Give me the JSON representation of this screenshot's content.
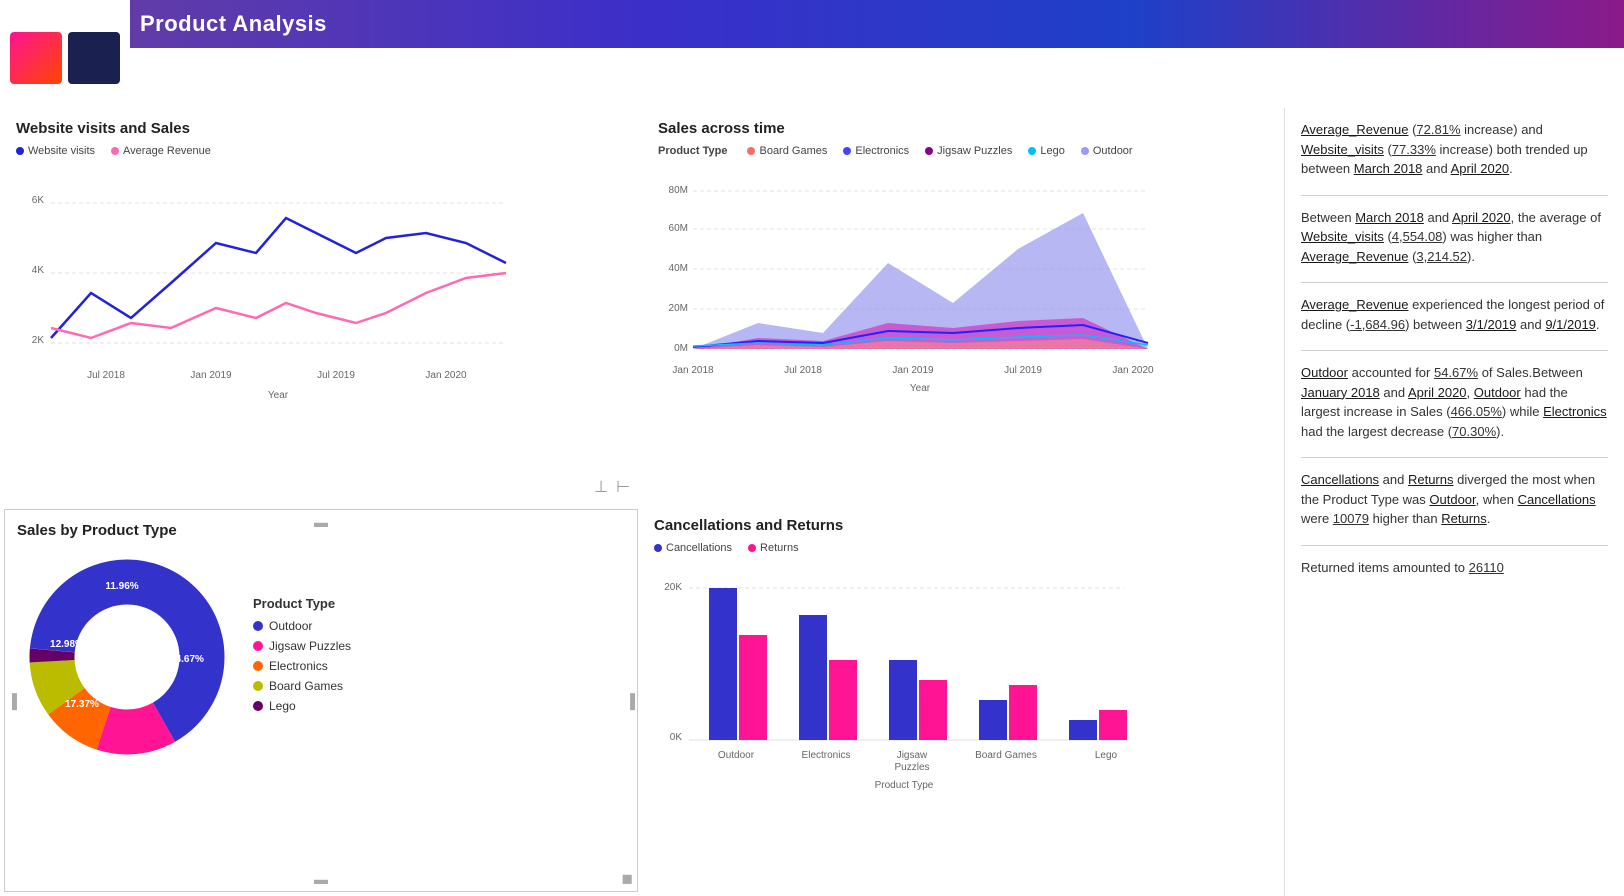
{
  "header": {
    "title": "Product Analysis"
  },
  "websiteChart": {
    "title": "Website visits and Sales",
    "legend": [
      {
        "label": "Website visits",
        "color": "#2222DD"
      },
      {
        "label": "Average Revenue",
        "color": "#FF69B4"
      }
    ],
    "xLabels": [
      "Jul 2018",
      "Jan 2019",
      "Jul 2019",
      "Jan 2020"
    ],
    "yLabels": [
      "6K",
      "4K",
      "2K"
    ],
    "xAxisLabel": "Year"
  },
  "salesTimeChart": {
    "title": "Sales across time",
    "legendLabel": "Product Type",
    "legend": [
      {
        "label": "Board Games",
        "color": "#FF6B6B"
      },
      {
        "label": "Electronics",
        "color": "#4444FF"
      },
      {
        "label": "Jigsaw Puzzles",
        "color": "#880088"
      },
      {
        "label": "Lego",
        "color": "#00BFFF"
      },
      {
        "label": "Outdoor",
        "color": "#9999FF"
      }
    ],
    "yLabels": [
      "80M",
      "60M",
      "40M",
      "20M",
      "0M"
    ],
    "xLabels": [
      "Jan 2018",
      "Jul 2018",
      "Jan 2019",
      "Jul 2019",
      "Jan 2020"
    ],
    "xAxisLabel": "Year"
  },
  "salesByProduct": {
    "title": "Sales by Product Type",
    "segments": [
      {
        "label": "Outdoor",
        "color": "#3333CC",
        "percent": "54.67%",
        "value": 54.67
      },
      {
        "label": "Jigsaw Puzzles",
        "color": "#FF1493",
        "percent": "17.37%",
        "value": 17.37
      },
      {
        "label": "Electronics",
        "color": "#FF6600",
        "percent": "12.98%",
        "value": 12.98
      },
      {
        "label": "Board Games",
        "color": "#CCCC00",
        "percent": "11.96%",
        "value": 11.96
      },
      {
        "label": "Lego",
        "color": "#660066",
        "percent": "3.02%",
        "value": 3.02
      }
    ],
    "legend": {
      "title": "Product Type",
      "items": [
        {
          "label": "Outdoor",
          "color": "#3333CC"
        },
        {
          "label": "Jigsaw Puzzles",
          "color": "#FF1493"
        },
        {
          "label": "Electronics",
          "color": "#FF6600"
        },
        {
          "label": "Board Games",
          "color": "#CCCC00"
        },
        {
          "label": "Lego",
          "color": "#660066"
        }
      ]
    }
  },
  "cancellationsChart": {
    "title": "Cancellations and Returns",
    "legend": [
      {
        "label": "Cancellations",
        "color": "#3333CC"
      },
      {
        "label": "Returns",
        "color": "#FF1493"
      }
    ],
    "yLabels": [
      "20K",
      "0K"
    ],
    "xLabels": [
      "Outdoor",
      "Electronics",
      "Jigsaw Puzzles",
      "Board Games",
      "Lego"
    ],
    "xAxisLabel": "Product Type",
    "bars": [
      {
        "cancellations": 0.95,
        "returns": 0.62
      },
      {
        "cancellations": 0.7,
        "returns": 0.42
      },
      {
        "cancellations": 0.42,
        "returns": 0.28
      },
      {
        "cancellations": 0.22,
        "returns": 0.3
      },
      {
        "cancellations": 0.1,
        "returns": 0.15
      }
    ]
  },
  "insights": {
    "paragraphs": [
      "Average_Revenue (72.81% increase) and Website_visits (77.33% increase) both trended up between March 2018 and April 2020.",
      "Between March 2018 and April 2020, the average of Website_visits (4,554.08) was higher than Average_Revenue (3,214.52).",
      "Average_Revenue experienced the longest period of decline (-1,684.96) between 3/1/2019 and 9/1/2019.",
      "Outdoor accounted for 54.67% of Sales.Between January 2018 and April 2020, Outdoor had the largest increase in Sales (466.05%) while Electronics had the largest decrease (70.30%).",
      "Cancellations and Returns diverged the most when the Product Type was Outdoor, when Cancellations were 10079 higher than Returns.",
      "Returned items amounted to 26110"
    ]
  }
}
